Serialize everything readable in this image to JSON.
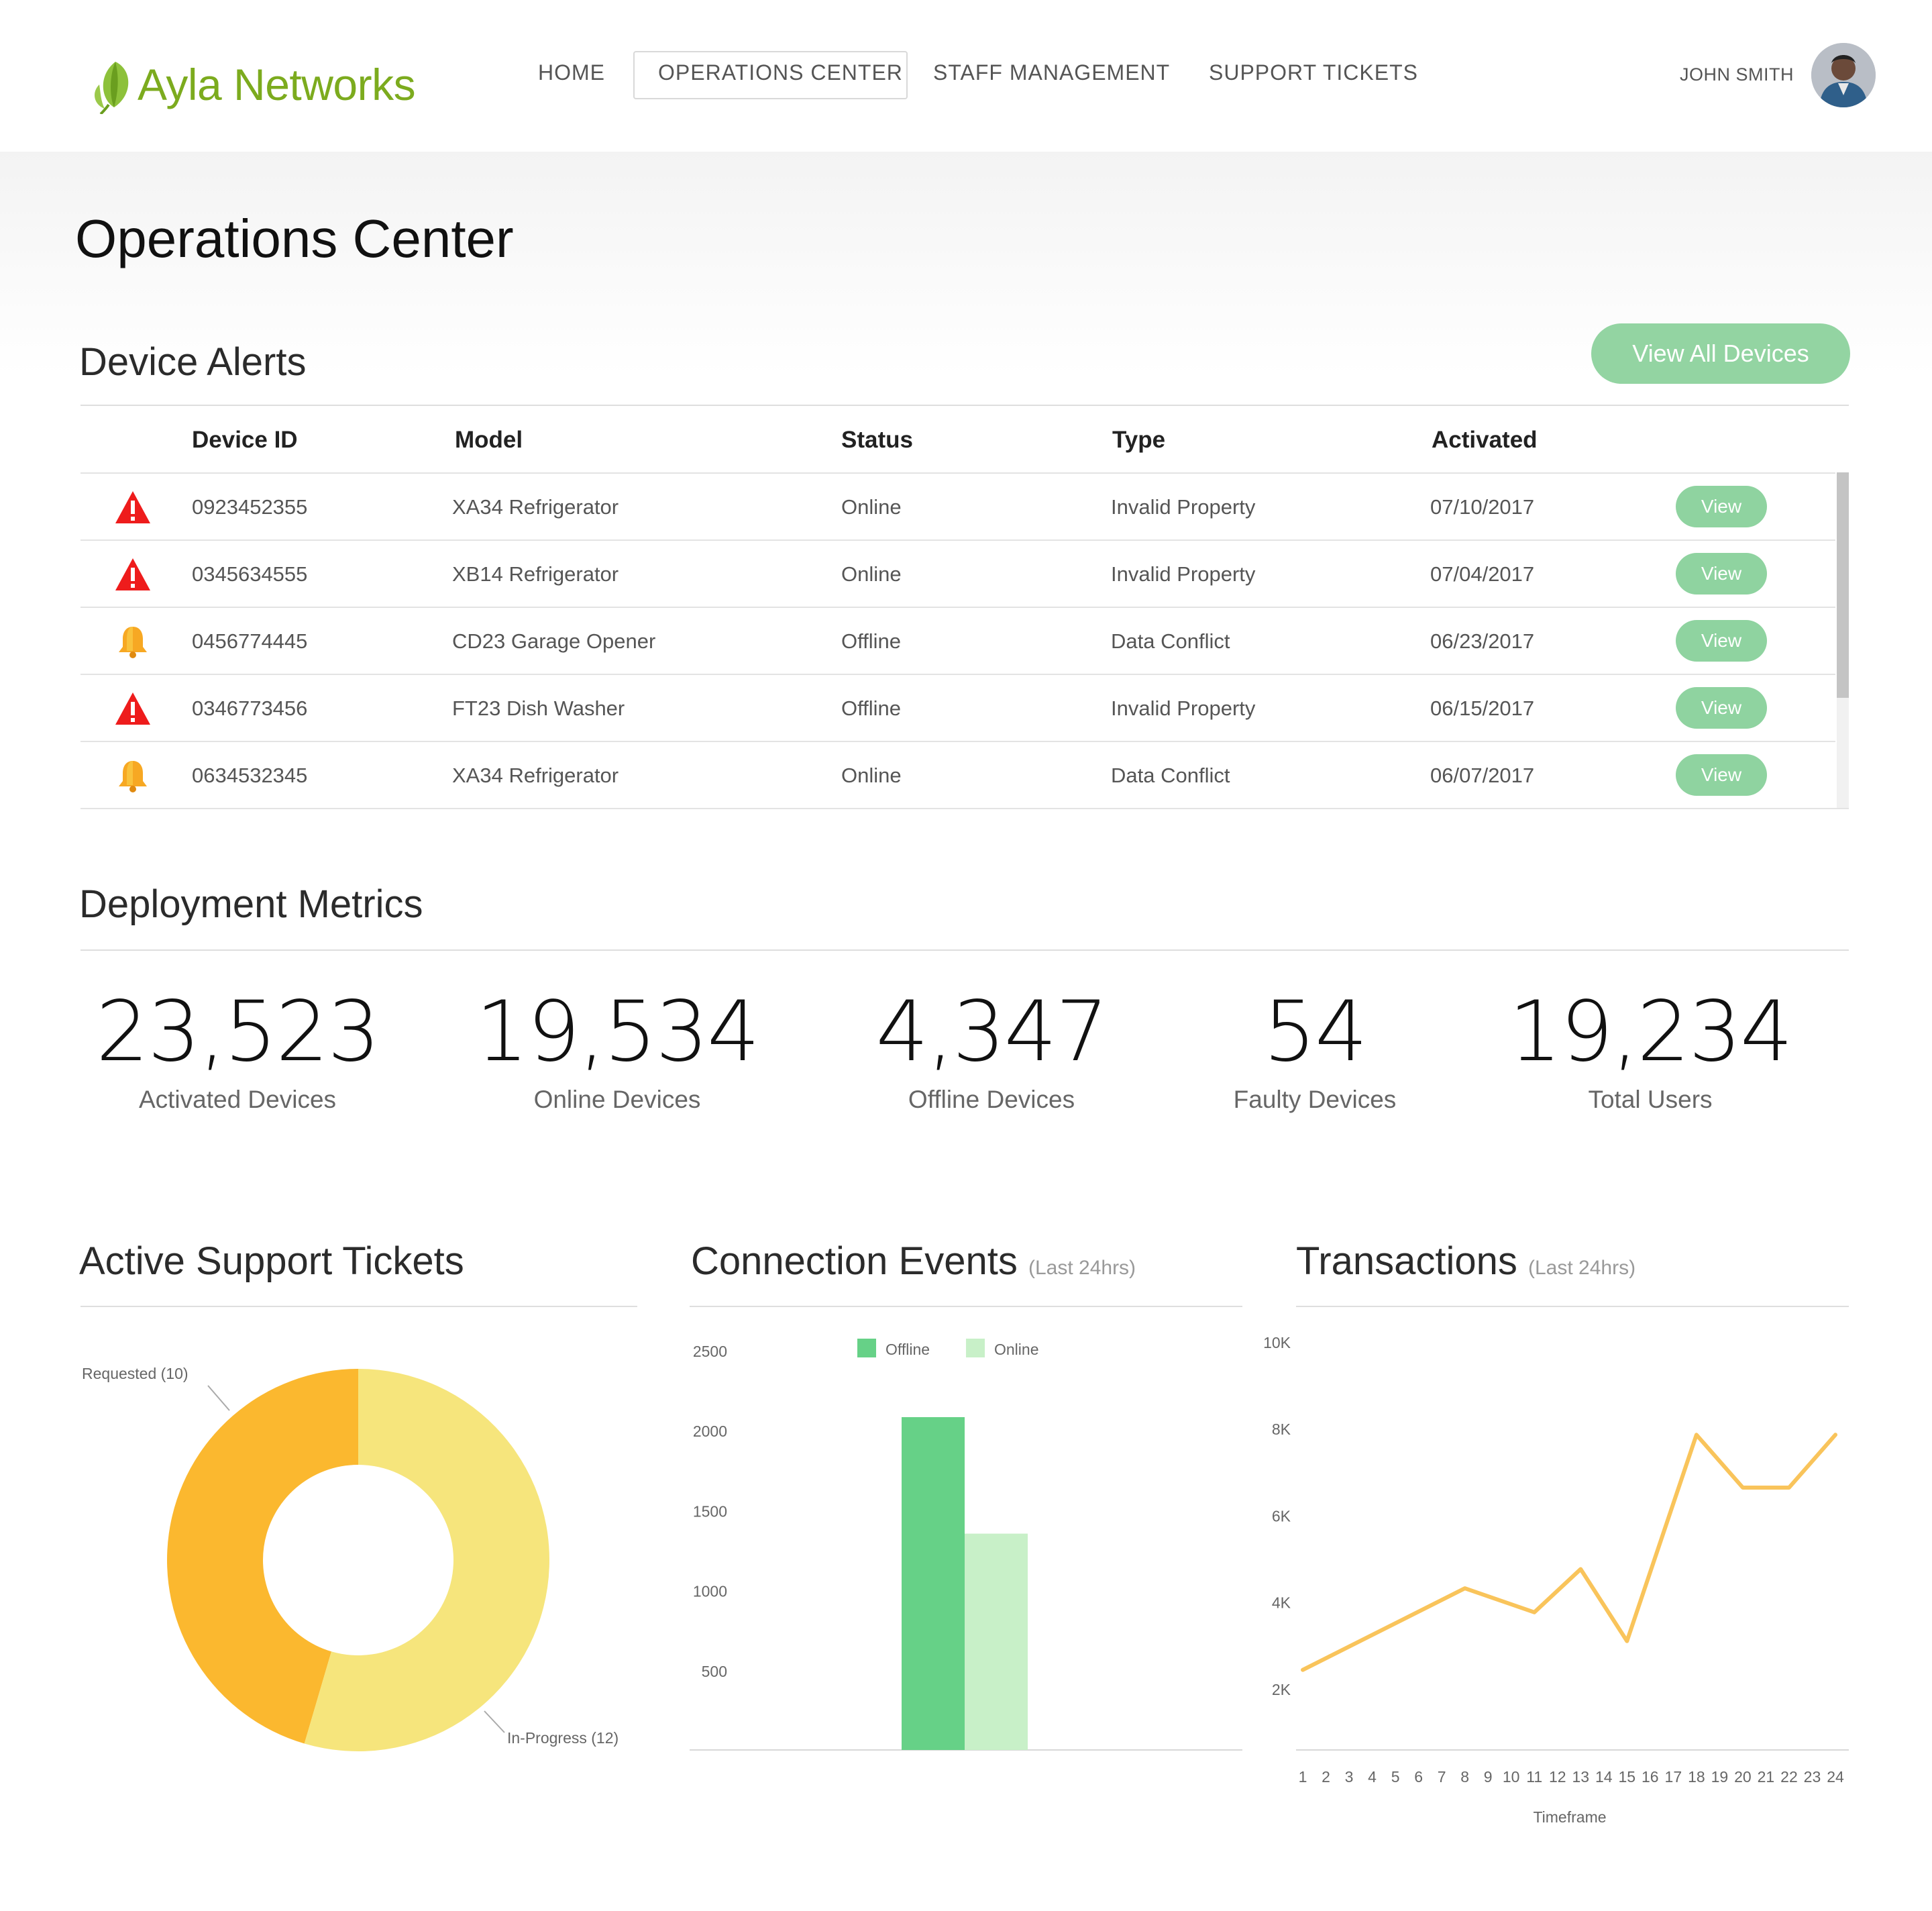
{
  "header": {
    "brand": "Ayla Networks",
    "nav": [
      "HOME",
      "OPERATIONS CENTER",
      "STAFF MANAGEMENT",
      "SUPPORT TICKETS"
    ],
    "active_nav": "OPERATIONS CENTER",
    "user_name": "JOHN SMITH"
  },
  "page_title": "Operations Center",
  "alerts": {
    "title": "Device Alerts",
    "view_all_label": "View All Devices",
    "columns": [
      "Device ID",
      "Model",
      "Status",
      "Type",
      "Activated"
    ],
    "rows": [
      {
        "icon": "warning-icon",
        "device_id": "0923452355",
        "model": "XA34 Refrigerator",
        "status": "Online",
        "type": "Invalid Property",
        "activated": "07/10/2017",
        "action": "View"
      },
      {
        "icon": "warning-icon",
        "device_id": "0345634555",
        "model": "XB14 Refrigerator",
        "status": "Online",
        "type": "Invalid Property",
        "activated": "07/04/2017",
        "action": "View"
      },
      {
        "icon": "bell-icon",
        "device_id": "0456774445",
        "model": "CD23 Garage Opener",
        "status": "Offline",
        "type": "Data Conflict",
        "activated": "06/23/2017",
        "action": "View"
      },
      {
        "icon": "warning-icon",
        "device_id": "0346773456",
        "model": "FT23 Dish Washer",
        "status": "Offline",
        "type": "Invalid Property",
        "activated": "06/15/2017",
        "action": "View"
      },
      {
        "icon": "bell-icon",
        "device_id": "0634532345",
        "model": "XA34 Refrigerator",
        "status": "Online",
        "type": "Data Conflict",
        "activated": "06/07/2017",
        "action": "View"
      }
    ]
  },
  "metrics": {
    "title": "Deployment Metrics",
    "items": [
      {
        "value": "23,523",
        "label": "Activated Devices"
      },
      {
        "value": "19,534",
        "label": "Online Devices"
      },
      {
        "value": "4,347",
        "label": "Offline Devices"
      },
      {
        "value": "54",
        "label": "Faulty Devices"
      },
      {
        "value": "19,234",
        "label": "Total Users"
      }
    ]
  },
  "tickets": {
    "title": "Active Support Tickets"
  },
  "connection": {
    "title": "Connection Events",
    "subtitle": "(Last 24hrs)"
  },
  "transactions": {
    "title": "Transactions",
    "subtitle": "(Last 24hrs)"
  },
  "colors": {
    "brand_green": "#7cab1e",
    "button_green": "#8fd3a0",
    "offline_bar": "#66d187",
    "online_bar": "#c8f0c8",
    "requested": "#fbb82f",
    "in_progress": "#f6e57c",
    "line": "#f9c45b",
    "alert_red": "#ee1c1c",
    "bell_orange": "#f7a823"
  },
  "chart_data": [
    {
      "type": "pie",
      "donut": true,
      "categories": [
        "Requested",
        "In-Progress"
      ],
      "labels": [
        "Requested (10)",
        "In-Progress (12)"
      ],
      "values": [
        10,
        12
      ]
    },
    {
      "type": "bar",
      "legend": [
        "Offline",
        "Online"
      ],
      "series": [
        {
          "name": "Offline",
          "values": [
            2000
          ]
        },
        {
          "name": "Online",
          "values": [
            1300
          ]
        }
      ],
      "yticks": [
        500,
        1000,
        1500,
        2000,
        2500
      ],
      "ylim": [
        0,
        2500
      ],
      "grid": false,
      "legend_position": "top-center"
    },
    {
      "type": "line",
      "x": [
        1,
        2,
        3,
        4,
        5,
        6,
        7,
        8,
        9,
        10,
        11,
        12,
        13,
        14,
        15,
        16,
        17,
        18,
        19,
        20,
        21,
        22,
        23,
        24
      ],
      "xticks": [
        "1",
        "2",
        "3",
        "4",
        "5",
        "6",
        "7",
        "8",
        "9",
        "10",
        "11",
        "12",
        "13",
        "14",
        "15",
        "16",
        "17",
        "18",
        "19",
        "20",
        "21",
        "22",
        "23",
        "24"
      ],
      "points_x": [
        1,
        8,
        11,
        13,
        15,
        18,
        20,
        22,
        24
      ],
      "values": [
        2900,
        4600,
        4100,
        5000,
        3500,
        7800,
        6700,
        6700,
        7800
      ],
      "ylabels": [
        "2K",
        "4K",
        "6K",
        "8K",
        "10K"
      ],
      "yticks": [
        2000,
        4000,
        6000,
        8000,
        10000
      ],
      "ylim": [
        0,
        10000
      ],
      "xlabel": "Timeframe",
      "grid": false
    }
  ]
}
